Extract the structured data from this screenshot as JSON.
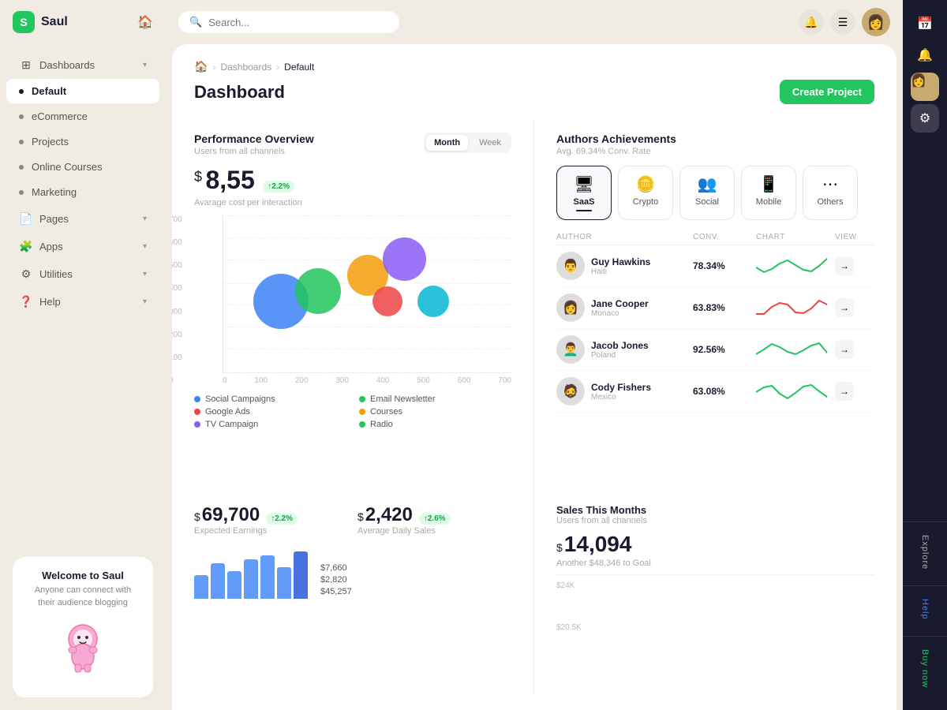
{
  "brand": {
    "name": "Saul",
    "logo": "S"
  },
  "search": {
    "placeholder": "Search..."
  },
  "nav": {
    "items": [
      {
        "id": "dashboards",
        "label": "Dashboards",
        "icon": "⊞",
        "type": "icon",
        "chevron": true,
        "active": false
      },
      {
        "id": "default",
        "label": "Default",
        "type": "dot",
        "active": true
      },
      {
        "id": "ecommerce",
        "label": "eCommerce",
        "type": "dot",
        "active": false
      },
      {
        "id": "projects",
        "label": "Projects",
        "type": "dot",
        "active": false
      },
      {
        "id": "online-courses",
        "label": "Online Courses",
        "type": "dot",
        "active": false
      },
      {
        "id": "marketing",
        "label": "Marketing",
        "type": "dot",
        "active": false
      },
      {
        "id": "pages",
        "label": "Pages",
        "icon": "📄",
        "type": "icon",
        "chevron": true,
        "active": false
      },
      {
        "id": "apps",
        "label": "Apps",
        "icon": "🧩",
        "type": "icon",
        "chevron": true,
        "active": false
      },
      {
        "id": "utilities",
        "label": "Utilities",
        "icon": "⚙",
        "type": "icon",
        "chevron": true,
        "active": false
      },
      {
        "id": "help",
        "label": "Help",
        "icon": "❓",
        "type": "icon",
        "chevron": true,
        "active": false
      }
    ]
  },
  "welcome": {
    "title": "Welcome to Saul",
    "subtitle": "Anyone can connect with their audience blogging"
  },
  "breadcrumb": {
    "home": "🏠",
    "items": [
      "Dashboards",
      "Default"
    ]
  },
  "page": {
    "title": "Dashboard"
  },
  "create_btn": "Create Project",
  "performance": {
    "title": "Performance Overview",
    "subtitle": "Users from all channels",
    "toggle": {
      "month": "Month",
      "week": "Week",
      "active": "Month"
    },
    "stat": {
      "currency": "$",
      "amount": "8,55",
      "badge": "↑2.2%",
      "label": "Avarage cost per interaction"
    },
    "y_axis": [
      "700",
      "600",
      "500",
      "400",
      "300",
      "200",
      "100",
      "0"
    ],
    "x_axis": [
      "0",
      "100",
      "200",
      "300",
      "400",
      "500",
      "600",
      "700"
    ],
    "bubbles": [
      {
        "color": "#3b82f6",
        "size": 70,
        "x": 20,
        "y": 55,
        "label": "Social Campaigns"
      },
      {
        "color": "#22c55e",
        "size": 58,
        "x": 33,
        "y": 48,
        "label": "Email Newsletter"
      },
      {
        "color": "#f59e0b",
        "size": 52,
        "x": 50,
        "y": 38,
        "label": "Courses"
      },
      {
        "color": "#8b5cf6",
        "size": 55,
        "x": 63,
        "y": 28,
        "label": "TV Campaign"
      },
      {
        "color": "#ef4444",
        "size": 38,
        "x": 57,
        "y": 55,
        "label": "Google Ads"
      },
      {
        "color": "#06b6d4",
        "size": 40,
        "x": 73,
        "y": 55,
        "label": "Radio"
      }
    ],
    "legend": [
      {
        "label": "Social Campaigns",
        "color": "#3b82f6"
      },
      {
        "label": "Email Newsletter",
        "color": "#22c55e"
      },
      {
        "label": "Google Ads",
        "color": "#ef4444"
      },
      {
        "label": "Courses",
        "color": "#f59e0b"
      },
      {
        "label": "TV Campaign",
        "color": "#8b5cf6"
      },
      {
        "label": "Radio",
        "color": "#22c55e"
      }
    ]
  },
  "authors": {
    "title": "Authors Achievements",
    "subtitle": "Avg. 69.34% Conv. Rate",
    "tabs": [
      {
        "id": "saas",
        "label": "SaaS",
        "icon": "🖥",
        "active": true
      },
      {
        "id": "crypto",
        "label": "Crypto",
        "icon": "🪙",
        "active": false
      },
      {
        "id": "social",
        "label": "Social",
        "icon": "👥",
        "active": false
      },
      {
        "id": "mobile",
        "label": "Mobile",
        "icon": "📱",
        "active": false
      },
      {
        "id": "others",
        "label": "Others",
        "icon": "⋯",
        "active": false
      }
    ],
    "columns": [
      "Author",
      "Conv.",
      "Chart",
      "View"
    ],
    "rows": [
      {
        "name": "Guy Hawkins",
        "country": "Haiti",
        "conv": "78.34%",
        "wave_color": "#22c55e",
        "avatar": "👨"
      },
      {
        "name": "Jane Cooper",
        "country": "Monaco",
        "conv": "63.83%",
        "wave_color": "#ef4444",
        "avatar": "👩"
      },
      {
        "name": "Jacob Jones",
        "country": "Poland",
        "conv": "92.56%",
        "wave_color": "#22c55e",
        "avatar": "👨‍🦱"
      },
      {
        "name": "Cody Fishers",
        "country": "Mexico",
        "conv": "63.08%",
        "wave_color": "#22c55e",
        "avatar": "🧔"
      }
    ]
  },
  "earnings": {
    "expected": {
      "currency": "$",
      "amount": "69,700",
      "badge": "↑2.2%",
      "label": "Expected Earnings"
    },
    "daily": {
      "currency": "$",
      "amount": "2,420",
      "badge": "↑2.6%",
      "label": "Average Daily Sales"
    }
  },
  "amounts": [
    "$7,660",
    "$2,820",
    "$45,257"
  ],
  "sales": {
    "title": "Sales This Months",
    "subtitle": "Users from all channels",
    "currency": "$",
    "amount": "14,094",
    "goal_label": "Another $48,346 to Goal",
    "y_labels": [
      "$24K",
      "$20.5K"
    ]
  },
  "right_sidebar": {
    "labels": [
      "Explore",
      "Help",
      "Buy now"
    ]
  }
}
